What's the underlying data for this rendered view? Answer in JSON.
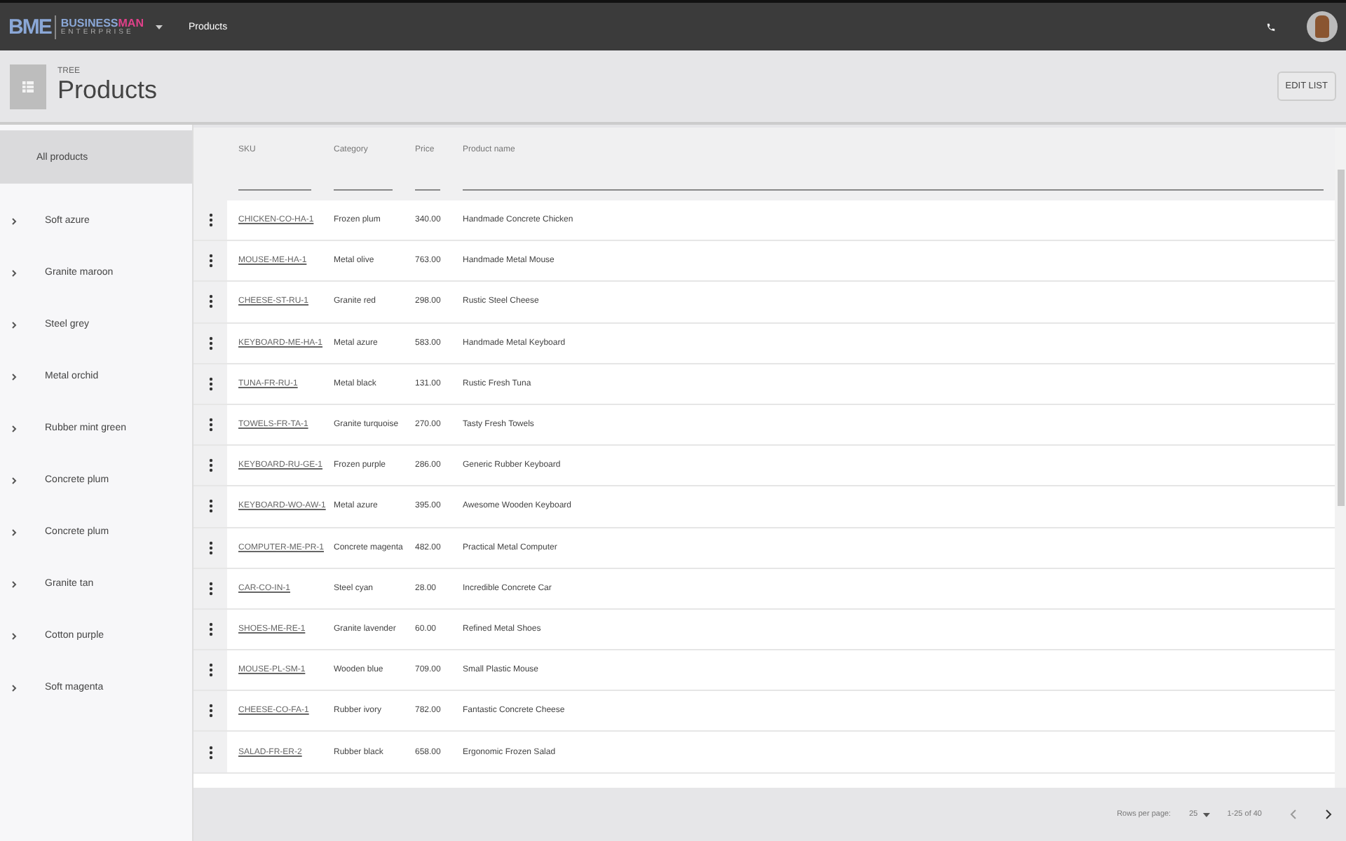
{
  "app_bar": {
    "logo": {
      "mark": "BME",
      "name_1": "BUSINESS",
      "name_2": "MAN",
      "tagline": "ENTERPRISE"
    },
    "breadcrumb": "Products"
  },
  "header": {
    "overline": "TREE",
    "title": "Products",
    "button": "EDIT LIST"
  },
  "sidebar": {
    "items": [
      {
        "label": "All products",
        "selected": true
      },
      {
        "label": "Soft azure",
        "selected": false,
        "expanded": false
      },
      {
        "label": "Granite maroon",
        "selected": false,
        "expanded": false
      },
      {
        "label": "Steel grey",
        "selected": false,
        "expanded": false
      },
      {
        "label": "Metal orchid",
        "selected": false,
        "expanded": false
      },
      {
        "label": "Rubber mint green",
        "selected": false,
        "expanded": false
      },
      {
        "label": "Concrete plum",
        "selected": false,
        "expanded": false
      },
      {
        "label": "Concrete plum",
        "selected": false,
        "expanded": false
      },
      {
        "label": "Granite tan",
        "selected": false,
        "expanded": false
      },
      {
        "label": "Cotton purple",
        "selected": false,
        "expanded": false
      },
      {
        "label": "Soft magenta",
        "selected": false,
        "expanded": false
      }
    ]
  },
  "table": {
    "columns": [
      "SKU",
      "Category",
      "Price",
      "Product name"
    ],
    "rows": [
      [
        "CHICKEN-CO-HA-1",
        "Frozen plum",
        "340.00",
        "Handmade Concrete Chicken"
      ],
      [
        "MOUSE-ME-HA-1",
        "Metal olive",
        "763.00",
        "Handmade Metal Mouse"
      ],
      [
        "CHEESE-ST-RU-1",
        "Granite red",
        "298.00",
        "Rustic Steel Cheese"
      ],
      [
        "KEYBOARD-ME-HA-1",
        "Metal azure",
        "583.00",
        "Handmade Metal Keyboard"
      ],
      [
        "TUNA-FR-RU-1",
        "Metal black",
        "131.00",
        "Rustic Fresh Tuna"
      ],
      [
        "TOWELS-FR-TA-1",
        "Granite turquoise",
        "270.00",
        "Tasty Fresh Towels"
      ],
      [
        "KEYBOARD-RU-GE-1",
        "Frozen purple",
        "286.00",
        "Generic Rubber Keyboard"
      ],
      [
        "KEYBOARD-WO-AW-1",
        "Metal azure",
        "395.00",
        "Awesome Wooden Keyboard"
      ],
      [
        "COMPUTER-ME-PR-1",
        "Concrete magenta",
        "482.00",
        "Practical Metal Computer"
      ],
      [
        "CAR-CO-IN-1",
        "Steel cyan",
        "28.00",
        "Incredible Concrete Car"
      ],
      [
        "SHOES-ME-RE-1",
        "Granite lavender",
        "60.00",
        "Refined Metal Shoes"
      ],
      [
        "MOUSE-PL-SM-1",
        "Wooden blue",
        "709.00",
        "Small Plastic Mouse"
      ],
      [
        "CHEESE-CO-FA-1",
        "Rubber ivory",
        "782.00",
        "Fantastic Concrete Cheese"
      ],
      [
        "SALAD-FR-ER-2",
        "Rubber black",
        "658.00",
        "Ergonomic Frozen Salad"
      ]
    ]
  },
  "pagination": {
    "rows_label": "Rows per page:",
    "rows_value": "25",
    "range": "1-25 of 40"
  }
}
